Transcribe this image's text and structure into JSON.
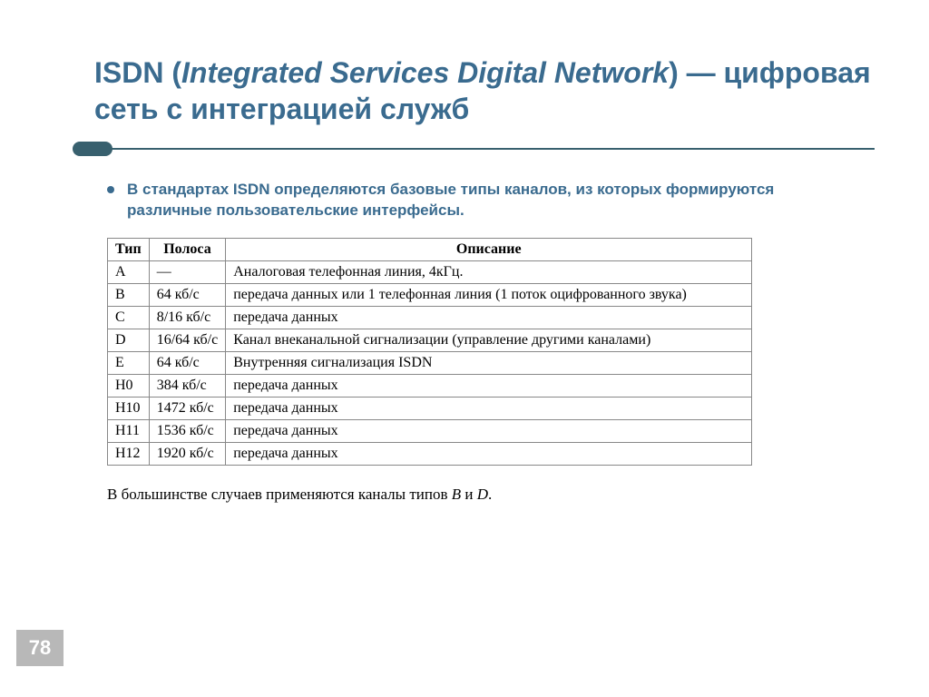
{
  "title": {
    "line1_bold": "ISDN",
    "line1_open_paren": " (",
    "line1_italic": "Integrated Services Digital Network",
    "line1_close_paren": ")",
    "rest": " — цифровая сеть с интеграцией служб"
  },
  "bullet": "В стандартах ISDN определяются базовые типы каналов, из которых формируются различные пользовательские интерфейсы.",
  "table": {
    "headers": [
      "Тип",
      "Полоса",
      "Описание"
    ],
    "rows": [
      [
        "A",
        "—",
        "Аналоговая телефонная линия, 4кГц."
      ],
      [
        "B",
        "64 кб/с",
        "передача данных или 1 телефонная линия (1 поток оцифрованного звука)"
      ],
      [
        "C",
        "8/16 кб/с",
        "передача данных"
      ],
      [
        "D",
        "16/64 кб/с",
        "Канал внеканальной сигнализации (управление другими каналами)"
      ],
      [
        "E",
        "64 кб/с",
        "Внутренняя сигнализация ISDN"
      ],
      [
        "H0",
        "384 кб/с",
        "передача данных"
      ],
      [
        "H10",
        "1472 кб/с",
        "передача данных"
      ],
      [
        "H11",
        "1536 кб/с",
        "передача данных"
      ],
      [
        "H12",
        "1920 кб/с",
        "передача данных"
      ]
    ]
  },
  "footnote": {
    "prefix": "В большинстве случаев применяются каналы типов ",
    "b": "B",
    "and": " и ",
    "d": "D",
    "suffix": "."
  },
  "page_number": "78"
}
